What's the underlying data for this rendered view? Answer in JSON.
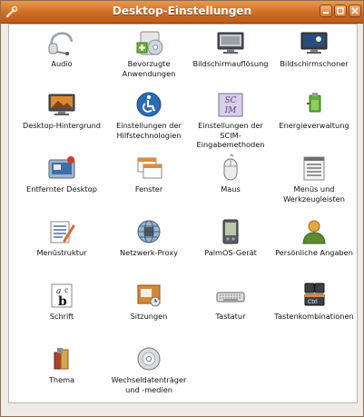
{
  "window": {
    "title": "Desktop-Einstellungen",
    "buttons": [
      "minimize",
      "maximize",
      "close"
    ]
  },
  "items": [
    {
      "label": "Audio",
      "icon": "headset-icon"
    },
    {
      "label": "Bevorzugte\nAnwendungen",
      "icon": "preferred-apps-icon"
    },
    {
      "label": "Bildschirmauflösung",
      "icon": "screen-resolution-icon"
    },
    {
      "label": "Bildschirmschoner",
      "icon": "screensaver-icon"
    },
    {
      "label": "Desktop-Hintergrund",
      "icon": "desktop-background-icon"
    },
    {
      "label": "Einstellungen der\nHilfstechnologien",
      "icon": "accessibility-icon"
    },
    {
      "label": "Einstellungen der\nSCIM-\nEingabemethoden",
      "icon": "scim-icon"
    },
    {
      "label": "Energieverwaltung",
      "icon": "power-management-icon"
    },
    {
      "label": "Entfernter Desktop",
      "icon": "remote-desktop-icon"
    },
    {
      "label": "Fenster",
      "icon": "windows-icon"
    },
    {
      "label": "Maus",
      "icon": "mouse-icon"
    },
    {
      "label": "Menüs und\nWerkzeugleisten",
      "icon": "menus-toolbars-icon"
    },
    {
      "label": "Menüstruktur",
      "icon": "menu-structure-icon"
    },
    {
      "label": "Netzwerk-Proxy",
      "icon": "network-proxy-icon"
    },
    {
      "label": "PalmOS-Gerät",
      "icon": "palm-device-icon"
    },
    {
      "label": "Persönliche Angaben",
      "icon": "personal-info-icon"
    },
    {
      "label": "Schrift",
      "icon": "font-icon"
    },
    {
      "label": "Sitzungen",
      "icon": "sessions-icon"
    },
    {
      "label": "Tastatur",
      "icon": "keyboard-icon"
    },
    {
      "label": "Tastenkombinationen",
      "icon": "keyboard-shortcuts-icon"
    },
    {
      "label": "Thema",
      "icon": "theme-icon"
    },
    {
      "label": "Wechseldatenträger\nund -medien",
      "icon": "removable-media-icon"
    }
  ]
}
